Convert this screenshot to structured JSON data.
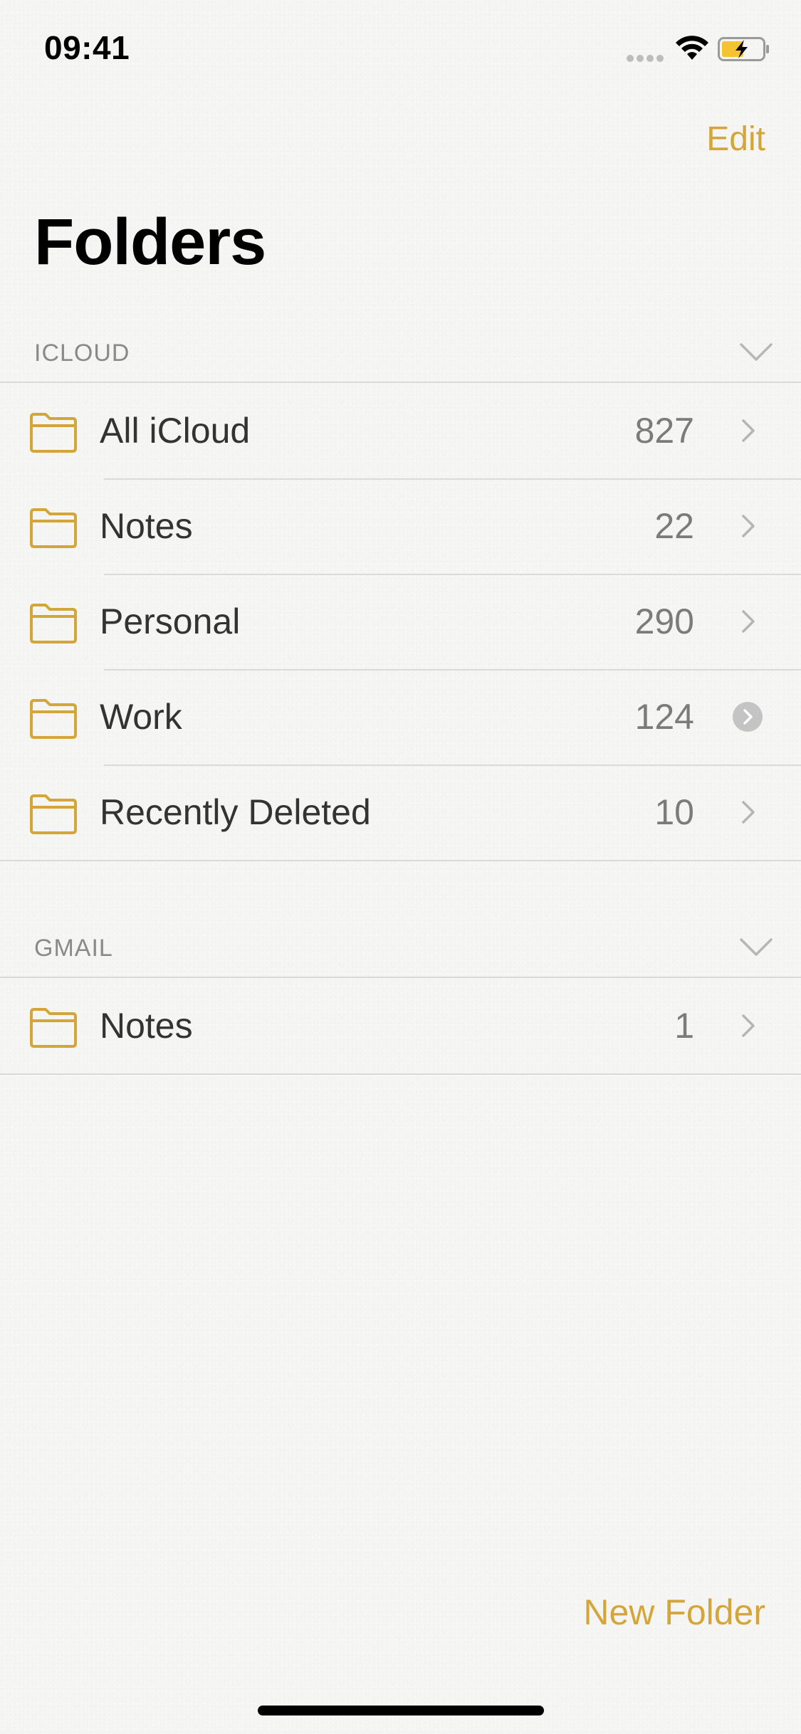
{
  "status_bar": {
    "time": "09:41",
    "wifi_icon": "wifi-icon",
    "battery_icon": "battery-charging-icon",
    "battery_color": "#f3c331"
  },
  "nav": {
    "edit_label": "Edit",
    "title": "Folders"
  },
  "accent_color": "#d4a63a",
  "sections": [
    {
      "label": "ICLOUD",
      "folders": [
        {
          "name": "All iCloud",
          "count": "827",
          "accessory": "chevron-right-icon"
        },
        {
          "name": "Notes",
          "count": "22",
          "accessory": "chevron-right-icon"
        },
        {
          "name": "Personal",
          "count": "290",
          "accessory": "chevron-right-icon"
        },
        {
          "name": "Work",
          "count": "124",
          "accessory": "chevron-circle-icon"
        },
        {
          "name": "Recently Deleted",
          "count": "10",
          "accessory": "chevron-right-icon"
        }
      ]
    },
    {
      "label": "GMAIL",
      "folders": [
        {
          "name": "Notes",
          "count": "1",
          "accessory": "chevron-right-icon"
        }
      ]
    }
  ],
  "toolbar": {
    "new_folder_label": "New Folder"
  }
}
